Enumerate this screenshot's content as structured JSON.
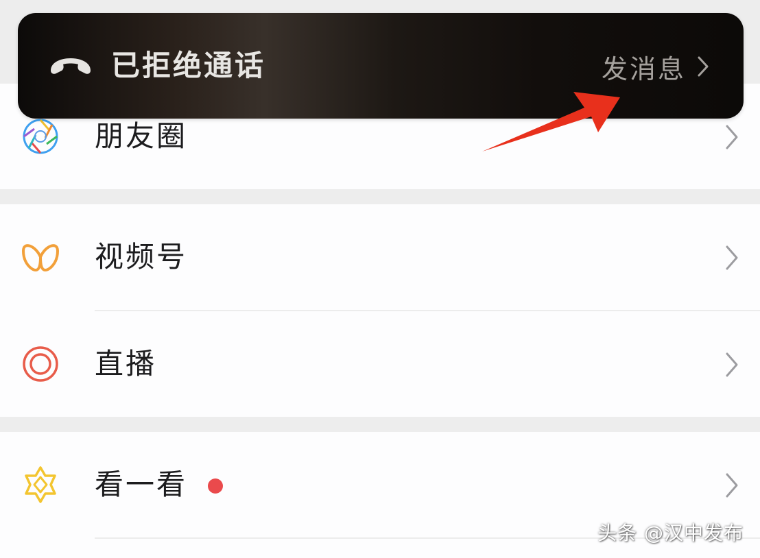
{
  "banner": {
    "title": "已拒绝通话",
    "action_label": "发消息",
    "icons": {
      "phone": "phone-hangup-icon",
      "chevron": "chevron-right-icon"
    }
  },
  "menu": {
    "items": [
      {
        "label": "朋友圈",
        "icon": "moments-aperture-icon",
        "has_dot": false
      },
      {
        "label": "视频号",
        "icon": "channels-icon",
        "has_dot": false
      },
      {
        "label": "直播",
        "icon": "live-icon",
        "has_dot": false
      },
      {
        "label": "看一看",
        "icon": "top-stories-icon",
        "has_dot": true
      }
    ]
  },
  "watermark": "头条 @汉中发布",
  "colors": {
    "banner_bg": "#120e0c",
    "accent_red": "#ea4a4c",
    "arrow_red": "#e8301c",
    "channels_orange": "#f2a03a",
    "live_red": "#e85c4a",
    "topstories_yellow": "#f3c530"
  }
}
